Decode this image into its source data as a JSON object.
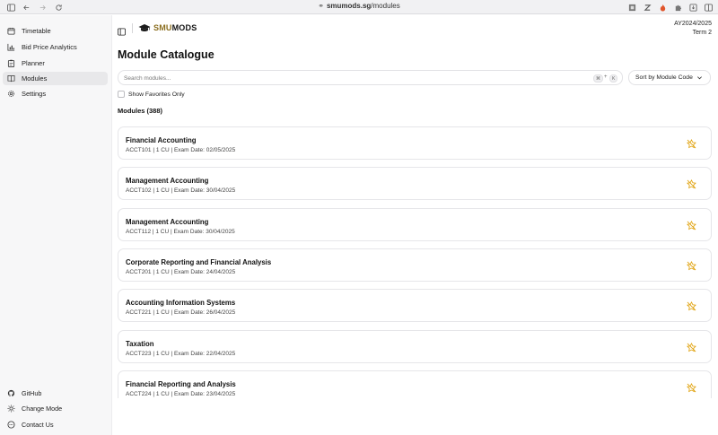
{
  "browser": {
    "url_domain": "smumods.sg",
    "url_path": "/modules"
  },
  "sidebar": {
    "items": [
      {
        "label": "Timetable",
        "icon": "calendar-icon"
      },
      {
        "label": "Bid Price Analytics",
        "icon": "bar-chart-icon"
      },
      {
        "label": "Planner",
        "icon": "clipboard-icon"
      },
      {
        "label": "Modules",
        "icon": "book-icon",
        "active": true
      },
      {
        "label": "Settings",
        "icon": "gear-icon"
      }
    ],
    "footer": [
      {
        "label": "GitHub",
        "icon": "github-icon"
      },
      {
        "label": "Change Mode",
        "icon": "sun-icon"
      },
      {
        "label": "Contact Us",
        "icon": "message-icon"
      }
    ]
  },
  "header": {
    "logo_smu": "SMU",
    "logo_mods": "MODS",
    "academic_year": "AY2024/2025",
    "term": "Term 2"
  },
  "main": {
    "title": "Module Catalogue",
    "search_placeholder": "Search modules...",
    "shortcut_key1": "⌘",
    "shortcut_plus": "+",
    "shortcut_key2": "K",
    "sort_label": "Sort by Module Code",
    "favorites_label": "Show Favorites Only",
    "count_label": "Modules (388)",
    "accent_color": "#e0a10b",
    "modules": [
      {
        "name": "Financial Accounting",
        "meta": "ACCT101 | 1 CU | Exam Date: 02/05/2025"
      },
      {
        "name": "Management Accounting",
        "meta": "ACCT102 | 1 CU | Exam Date: 30/04/2025"
      },
      {
        "name": "Management Accounting",
        "meta": "ACCT112 | 1 CU | Exam Date: 30/04/2025"
      },
      {
        "name": "Corporate Reporting and Financial Analysis",
        "meta": "ACCT201 | 1 CU | Exam Date: 24/04/2025"
      },
      {
        "name": "Accounting Information Systems",
        "meta": "ACCT221 | 1 CU | Exam Date: 26/04/2025"
      },
      {
        "name": "Taxation",
        "meta": "ACCT223 | 1 CU | Exam Date: 22/04/2025"
      },
      {
        "name": "Financial Reporting and Analysis",
        "meta": "ACCT224 | 1 CU | Exam Date: 23/04/2025"
      }
    ]
  }
}
